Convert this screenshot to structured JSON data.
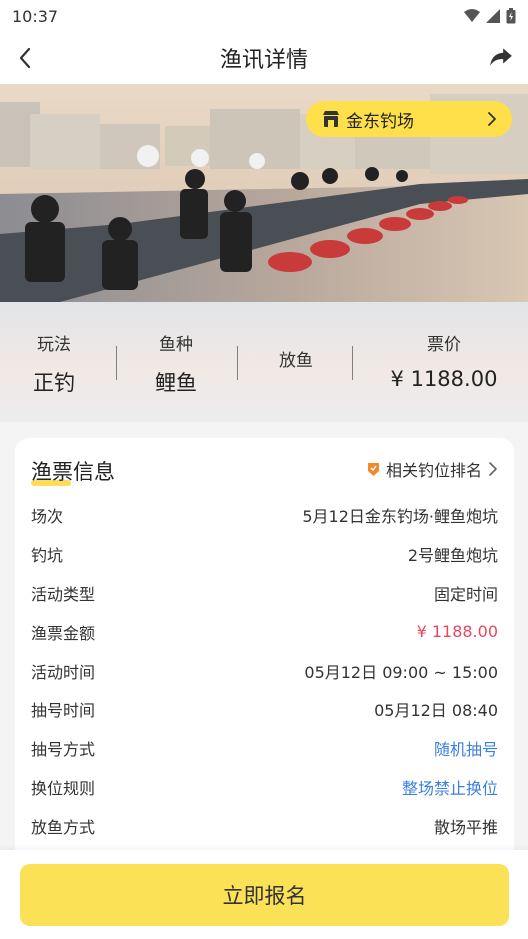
{
  "status_bar": {
    "time": "10:37"
  },
  "nav": {
    "title": "渔讯详情"
  },
  "venue": {
    "name": "金东钓场"
  },
  "summary": {
    "play_label": "玩法",
    "play_value": "正钓",
    "fish_label": "鱼种",
    "fish_value": "鲤鱼",
    "release_label": "放鱼",
    "price_label": "票价",
    "price_value": "¥ 1188.00"
  },
  "card": {
    "title": "渔票信息",
    "rank_link": "相关钓位排名",
    "rows": [
      {
        "label": "场次",
        "value": "5月12日金东钓场·鲤鱼炮坑"
      },
      {
        "label": "钓坑",
        "value": "2号鲤鱼炮坑"
      },
      {
        "label": "活动类型",
        "value": "固定时间"
      },
      {
        "label": "渔票金额",
        "value": "¥ 1188.00"
      },
      {
        "label": "活动时间",
        "value": "05月12日 09:00 ~ 15:00"
      },
      {
        "label": "抽号时间",
        "value": "05月12日 08:40"
      },
      {
        "label": "抽号方式",
        "value": "随机抽号"
      },
      {
        "label": "换位规则",
        "value": "整场禁止换位"
      },
      {
        "label": "放鱼方式",
        "value": "散场平推"
      }
    ]
  },
  "footer": {
    "signup_label": "立即报名"
  },
  "colors": {
    "accent_yellow": "#fbe155",
    "price_red": "#e8485f",
    "link_blue": "#3b7fe0"
  }
}
